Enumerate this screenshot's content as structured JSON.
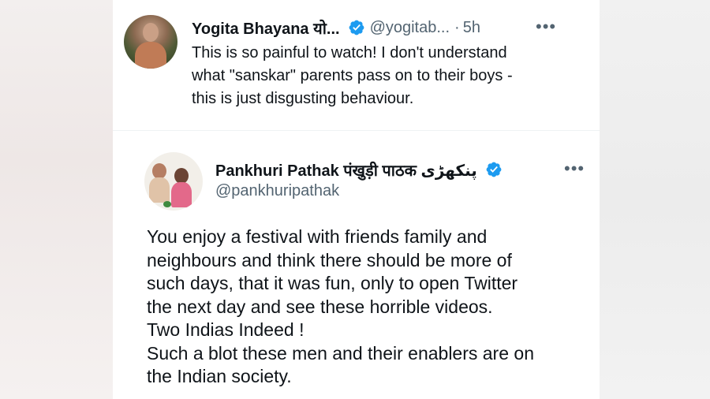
{
  "tweet1": {
    "display_name": "Yogita Bhayana यो...",
    "handle": "@yogitab...",
    "separator": "·",
    "time": "5h",
    "more": "•••",
    "lines": [
      "This is so painful to watch! I don't understand",
      "what \"sanskar\" parents pass on to their boys -",
      "this is just disgusting behaviour."
    ]
  },
  "tweet2": {
    "display_name": "Pankhuri Pathak पंखुड़ी पाठक پنکھڑی",
    "handle": "@pankhuripathak",
    "more": "•••",
    "lines": [
      "You enjoy a festival with friends family and",
      "neighbours and think there should be more of",
      "such days, that it was fun, only to open Twitter",
      "the next day and see these horrible videos.",
      "Two Indias Indeed !",
      "Such a blot these men and their enablers are on",
      "the Indian society."
    ]
  },
  "colors": {
    "verified_blue": "#1d9bf0",
    "text_primary": "#0f1419",
    "text_secondary": "#536471"
  },
  "icons": {
    "verified": "verified-badge-icon",
    "more": "more-options-icon"
  }
}
